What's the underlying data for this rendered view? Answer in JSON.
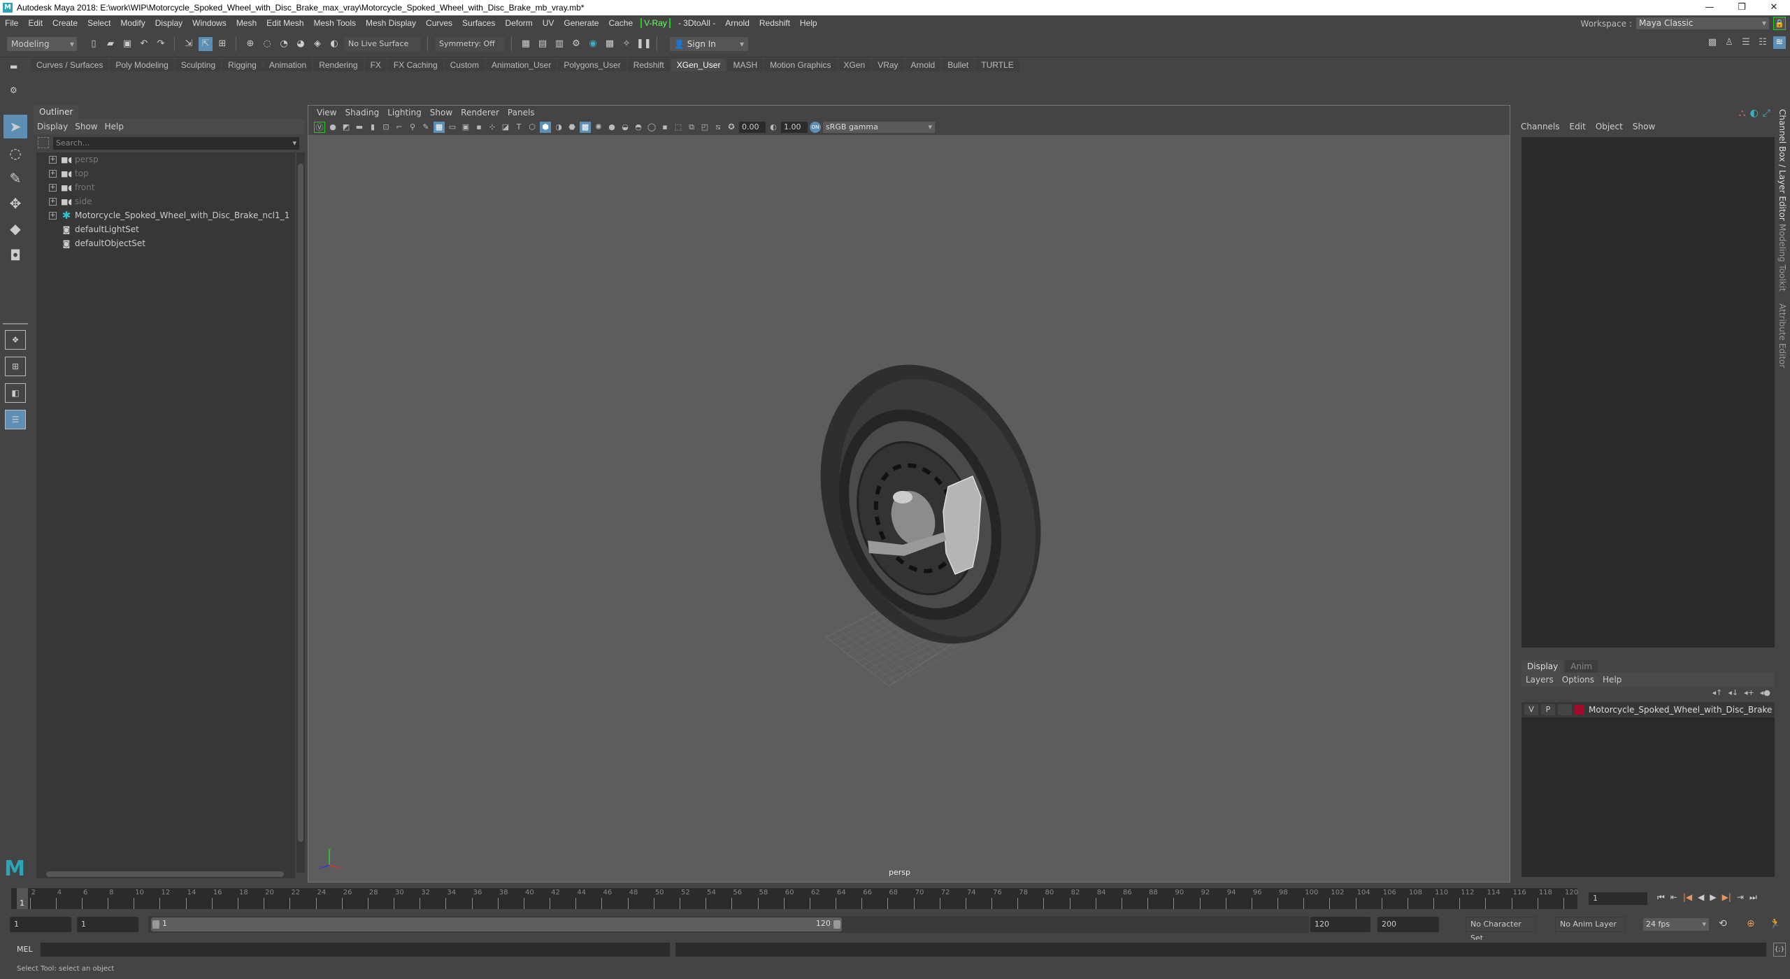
{
  "window": {
    "title": "Autodesk Maya 2018: E:\\work\\WIP\\Motorcycle_Spoked_Wheel_with_Disc_Brake_max_vray\\Motorcycle_Spoked_Wheel_with_Disc_Brake_mb_vray.mb*",
    "logo": "M",
    "minimize": "—",
    "restore": "❐",
    "close": "✕"
  },
  "menubar": [
    "File",
    "Edit",
    "Create",
    "Select",
    "Modify",
    "Display",
    "Windows",
    "Mesh",
    "Edit Mesh",
    "Mesh Tools",
    "Mesh Display",
    "Curves",
    "Surfaces",
    "Deform",
    "UV",
    "Generate",
    "Cache",
    "V-Ray",
    "- 3DtoAll -",
    "Arnold",
    "Redshift",
    "Help"
  ],
  "workspace": {
    "label": "Workspace :",
    "value": "Maya Classic"
  },
  "statusline": {
    "mode": "Modeling",
    "live_surface": "No Live Surface",
    "symmetry": "Symmetry: Off",
    "sign_in": "Sign In"
  },
  "shelf": {
    "tabs": [
      "Curves / Surfaces",
      "Poly Modeling",
      "Sculpting",
      "Rigging",
      "Animation",
      "Rendering",
      "FX",
      "FX Caching",
      "Custom",
      "Animation_User",
      "Polygons_User",
      "Redshift",
      "XGen_User",
      "MASH",
      "Motion Graphics",
      "XGen",
      "VRay",
      "Arnold",
      "Bullet",
      "TURTLE"
    ],
    "active_tab": "XGen_User"
  },
  "outliner": {
    "title": "Outliner",
    "menu": [
      "Display",
      "Show",
      "Help"
    ],
    "search_placeholder": "Search...",
    "items": [
      {
        "label": "persp",
        "icon": "camera-icon",
        "dim": true,
        "expandable": true
      },
      {
        "label": "top",
        "icon": "camera-icon",
        "dim": true,
        "expandable": true
      },
      {
        "label": "front",
        "icon": "camera-icon",
        "dim": true,
        "expandable": true
      },
      {
        "label": "side",
        "icon": "camera-icon",
        "dim": true,
        "expandable": true
      },
      {
        "label": "Motorcycle_Spoked_Wheel_with_Disc_Brake_ncl1_1",
        "icon": "transform-icon",
        "dim": false,
        "expandable": true
      },
      {
        "label": "defaultLightSet",
        "icon": "set-icon",
        "dim": false,
        "expandable": false
      },
      {
        "label": "defaultObjectSet",
        "icon": "set-icon",
        "dim": false,
        "expandable": false
      }
    ]
  },
  "viewport": {
    "menu": [
      "View",
      "Shading",
      "Lighting",
      "Show",
      "Renderer",
      "Panels"
    ],
    "exposure": "0.00",
    "gamma": "1.00",
    "color_mgmt_on": "ON",
    "color_space": "sRGB gamma",
    "camera": "persp",
    "axis": {
      "x": "x",
      "y": "y",
      "z": "z"
    }
  },
  "channelbox": {
    "menu": [
      "Channels",
      "Edit",
      "Object",
      "Show"
    ]
  },
  "sidetabs": [
    "Channel Box / Layer Editor",
    "Modeling Toolkit",
    "Attribute Editor"
  ],
  "layer_editor": {
    "tabs": [
      "Display",
      "Anim"
    ],
    "menu": [
      "Layers",
      "Options",
      "Help"
    ],
    "layers": [
      {
        "v": "V",
        "p": "P",
        "color": "#a10c2a",
        "name": "Motorcycle_Spoked_Wheel_with_Disc_Brake"
      }
    ]
  },
  "timeline": {
    "start": 1,
    "end": 120,
    "current": 1,
    "current_label": "1",
    "current_frame_field": "1",
    "playback": [
      "⏮",
      "⇤",
      "|◀",
      "◀",
      "▶",
      "▶|",
      "⇥",
      "⏭"
    ]
  },
  "range": {
    "start_field": "1",
    "playback_start_field": "1",
    "range_start_label": "1",
    "range_end_label": "120",
    "playback_end_field": "120",
    "end_field": "200",
    "character_set": "No Character Set",
    "anim_layer": "No Anim Layer",
    "fps": "24 fps"
  },
  "commandline": {
    "label": "MEL"
  },
  "helpline": {
    "text": "Select Tool: select an object"
  },
  "colors": {
    "accent": "#5d8fb5",
    "vray_green": "#22cc22",
    "maya_teal": "#2aa6b6",
    "layer_red": "#a10c2a"
  }
}
